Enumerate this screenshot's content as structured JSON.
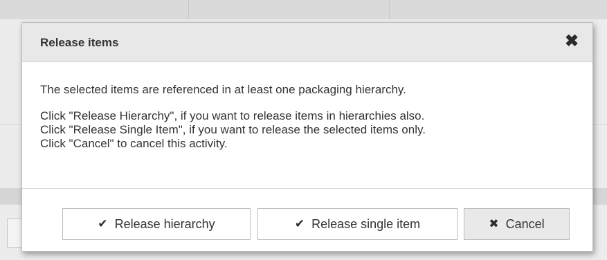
{
  "dialog": {
    "title": "Release items",
    "close_icon": "✖",
    "message": {
      "intro": "The selected items are referenced in at least one packaging hierarchy.",
      "lines": [
        "Click \"Release Hierarchy\", if you want to release items in hierarchies also.",
        "Click \"Release Single Item\", if you want to release the selected items only.",
        "Click \"Cancel\" to cancel this activity."
      ]
    },
    "buttons": {
      "release_hierarchy": {
        "label": "Release hierarchy",
        "icon": "✔"
      },
      "release_single": {
        "label": "Release single item",
        "icon": "✔"
      },
      "cancel": {
        "label": "Cancel",
        "icon": "✖"
      }
    }
  }
}
